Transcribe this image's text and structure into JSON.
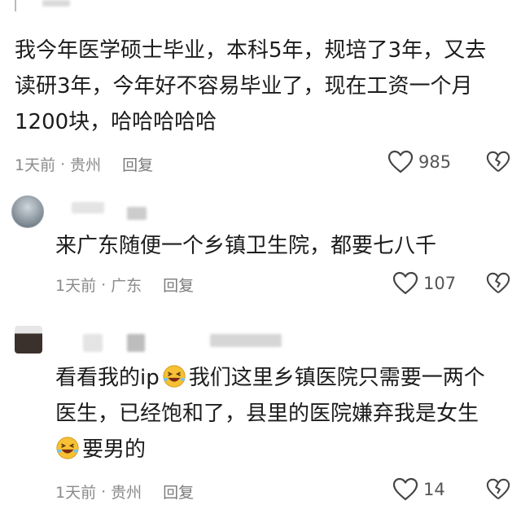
{
  "comments": [
    {
      "lines": [
        "我今年医学硕士毕业，本科5年，规培了3年，又去",
        "读研3年，今年好不容易毕业了，现在工资一个月",
        "1200块，哈哈哈哈哈"
      ],
      "time": "1天前",
      "location": "贵州",
      "reply_label": "回复",
      "likes": "985"
    },
    {
      "lines": [
        "来广东随便一个乡镇卫生院，都要七八千"
      ],
      "time": "1天前",
      "location": "广东",
      "reply_label": "回复",
      "likes": "107"
    },
    {
      "line1_a": "看看我的ip",
      "line1_b": "我们这里乡镇医院只需要一两个",
      "line2": "医生，已经饱和了，县里的医院嫌弃我是女生",
      "line3": "要男的",
      "time": "1天前",
      "location": "贵州",
      "reply_label": "回复",
      "likes": "14"
    }
  ],
  "separator": "·",
  "icons": [
    "heart-icon",
    "broken-heart-icon",
    "laughing-emoji-icon"
  ],
  "colors": {
    "text": "#1c1c1c",
    "meta": "#8a8a8a"
  }
}
